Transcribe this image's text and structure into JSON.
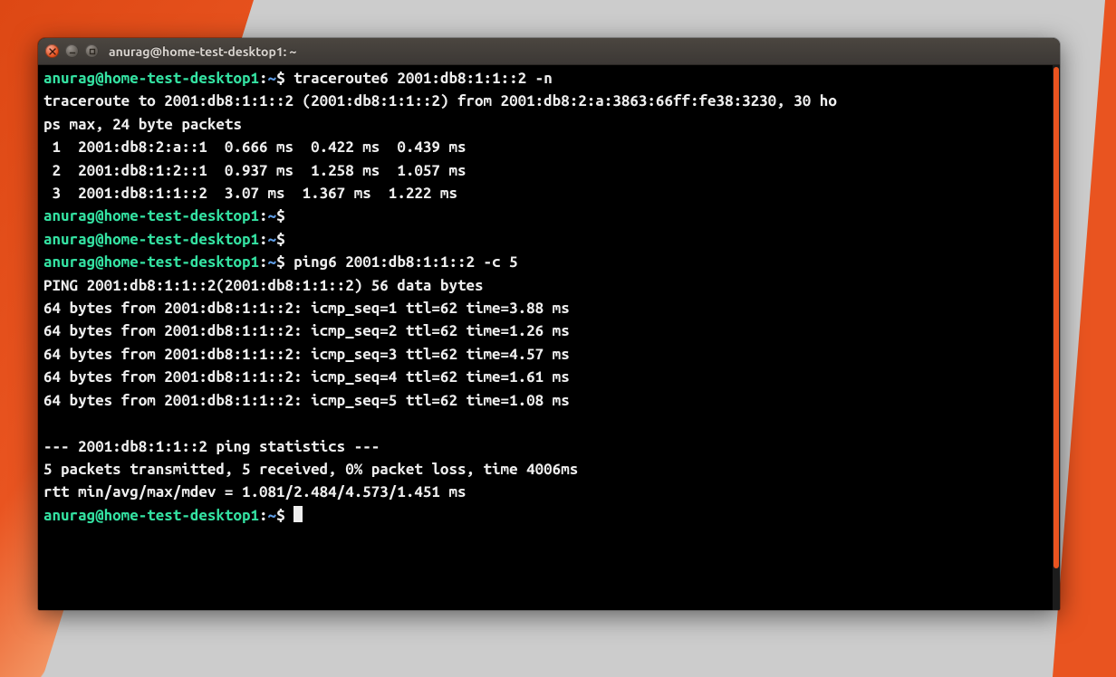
{
  "window": {
    "title": "anurag@home-test-desktop1: ~"
  },
  "prompt": {
    "user_host": "anurag@home-test-desktop1",
    "separator": ":",
    "path": "~",
    "symbol": "$"
  },
  "lines": [
    {
      "type": "prompt",
      "cmd": "traceroute6 2001:db8:1:1::2 -n"
    },
    {
      "type": "out",
      "text": "traceroute to 2001:db8:1:1::2 (2001:db8:1:1::2) from 2001:db8:2:a:3863:66ff:fe38:3230, 30 ho"
    },
    {
      "type": "out",
      "text": "ps max, 24 byte packets"
    },
    {
      "type": "out",
      "text": " 1  2001:db8:2:a::1  0.666 ms  0.422 ms  0.439 ms"
    },
    {
      "type": "out",
      "text": " 2  2001:db8:1:2::1  0.937 ms  1.258 ms  1.057 ms"
    },
    {
      "type": "out",
      "text": " 3  2001:db8:1:1::2  3.07 ms  1.367 ms  1.222 ms"
    },
    {
      "type": "prompt",
      "cmd": ""
    },
    {
      "type": "prompt",
      "cmd": ""
    },
    {
      "type": "prompt",
      "cmd": "ping6 2001:db8:1:1::2 -c 5"
    },
    {
      "type": "out",
      "text": "PING 2001:db8:1:1::2(2001:db8:1:1::2) 56 data bytes"
    },
    {
      "type": "out",
      "text": "64 bytes from 2001:db8:1:1::2: icmp_seq=1 ttl=62 time=3.88 ms"
    },
    {
      "type": "out",
      "text": "64 bytes from 2001:db8:1:1::2: icmp_seq=2 ttl=62 time=1.26 ms"
    },
    {
      "type": "out",
      "text": "64 bytes from 2001:db8:1:1::2: icmp_seq=3 ttl=62 time=4.57 ms"
    },
    {
      "type": "out",
      "text": "64 bytes from 2001:db8:1:1::2: icmp_seq=4 ttl=62 time=1.61 ms"
    },
    {
      "type": "out",
      "text": "64 bytes from 2001:db8:1:1::2: icmp_seq=5 ttl=62 time=1.08 ms"
    },
    {
      "type": "out",
      "text": ""
    },
    {
      "type": "out",
      "text": "--- 2001:db8:1:1::2 ping statistics ---"
    },
    {
      "type": "out",
      "text": "5 packets transmitted, 5 received, 0% packet loss, time 4006ms"
    },
    {
      "type": "out",
      "text": "rtt min/avg/max/mdev = 1.081/2.484/4.573/1.451 ms"
    },
    {
      "type": "prompt",
      "cmd": "",
      "cursor": true
    }
  ]
}
